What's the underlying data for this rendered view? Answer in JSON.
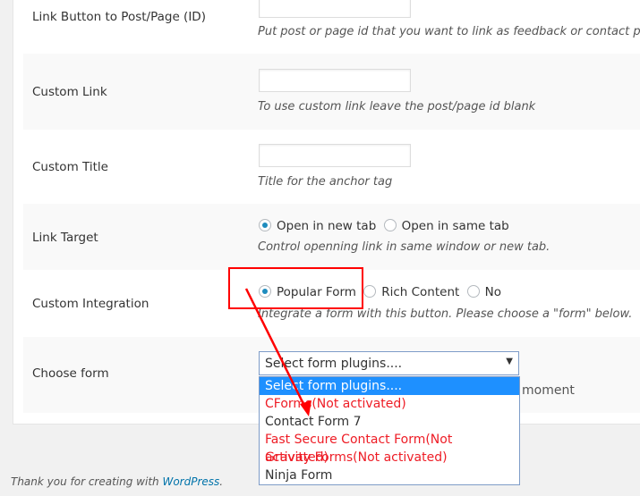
{
  "rows": [
    {
      "label": "Link Button to Post/Page (ID)",
      "desc": "Put post or page id that you want to link as feedback or contact page,"
    },
    {
      "label": "Custom Link",
      "desc": "To use custom link leave the post/page id blank"
    },
    {
      "label": "Custom Title",
      "desc": "Title for the anchor tag"
    },
    {
      "label": "Link Target",
      "options": [
        "Open in new tab",
        "Open in same tab"
      ],
      "selected": "Open in new tab",
      "desc": "Control openning link in same window or new tab."
    },
    {
      "label": "Custom Integration",
      "options": [
        "Popular Form",
        "Rich Content",
        "No"
      ],
      "selected": "Popular Form",
      "desc": "Integrate a form with this button. Please choose a \"form\" below."
    },
    {
      "label": "Choose form",
      "hidden_desc_fragment": "moment"
    }
  ],
  "select": {
    "value": "Select form plugins....",
    "options": [
      {
        "label": "Select form plugins....",
        "state": "highlighted"
      },
      {
        "label": "CForms(Not activated)",
        "state": "not-activated"
      },
      {
        "label": "Contact Form 7",
        "state": "active"
      },
      {
        "label": "Fast Secure Contact Form(Not activated)",
        "state": "not-activated"
      },
      {
        "label": "Gravity Forms(Not activated)",
        "state": "not-activated"
      },
      {
        "label": "Ninja Form",
        "state": "active"
      }
    ]
  },
  "footer": {
    "text": "Thank you for creating with ",
    "link": "WordPress",
    "end": "."
  },
  "colors": {
    "annotation": "#ff0000",
    "highlight": "#1e90ff",
    "not_activated": "#ee1c25",
    "link": "#0073aa"
  }
}
